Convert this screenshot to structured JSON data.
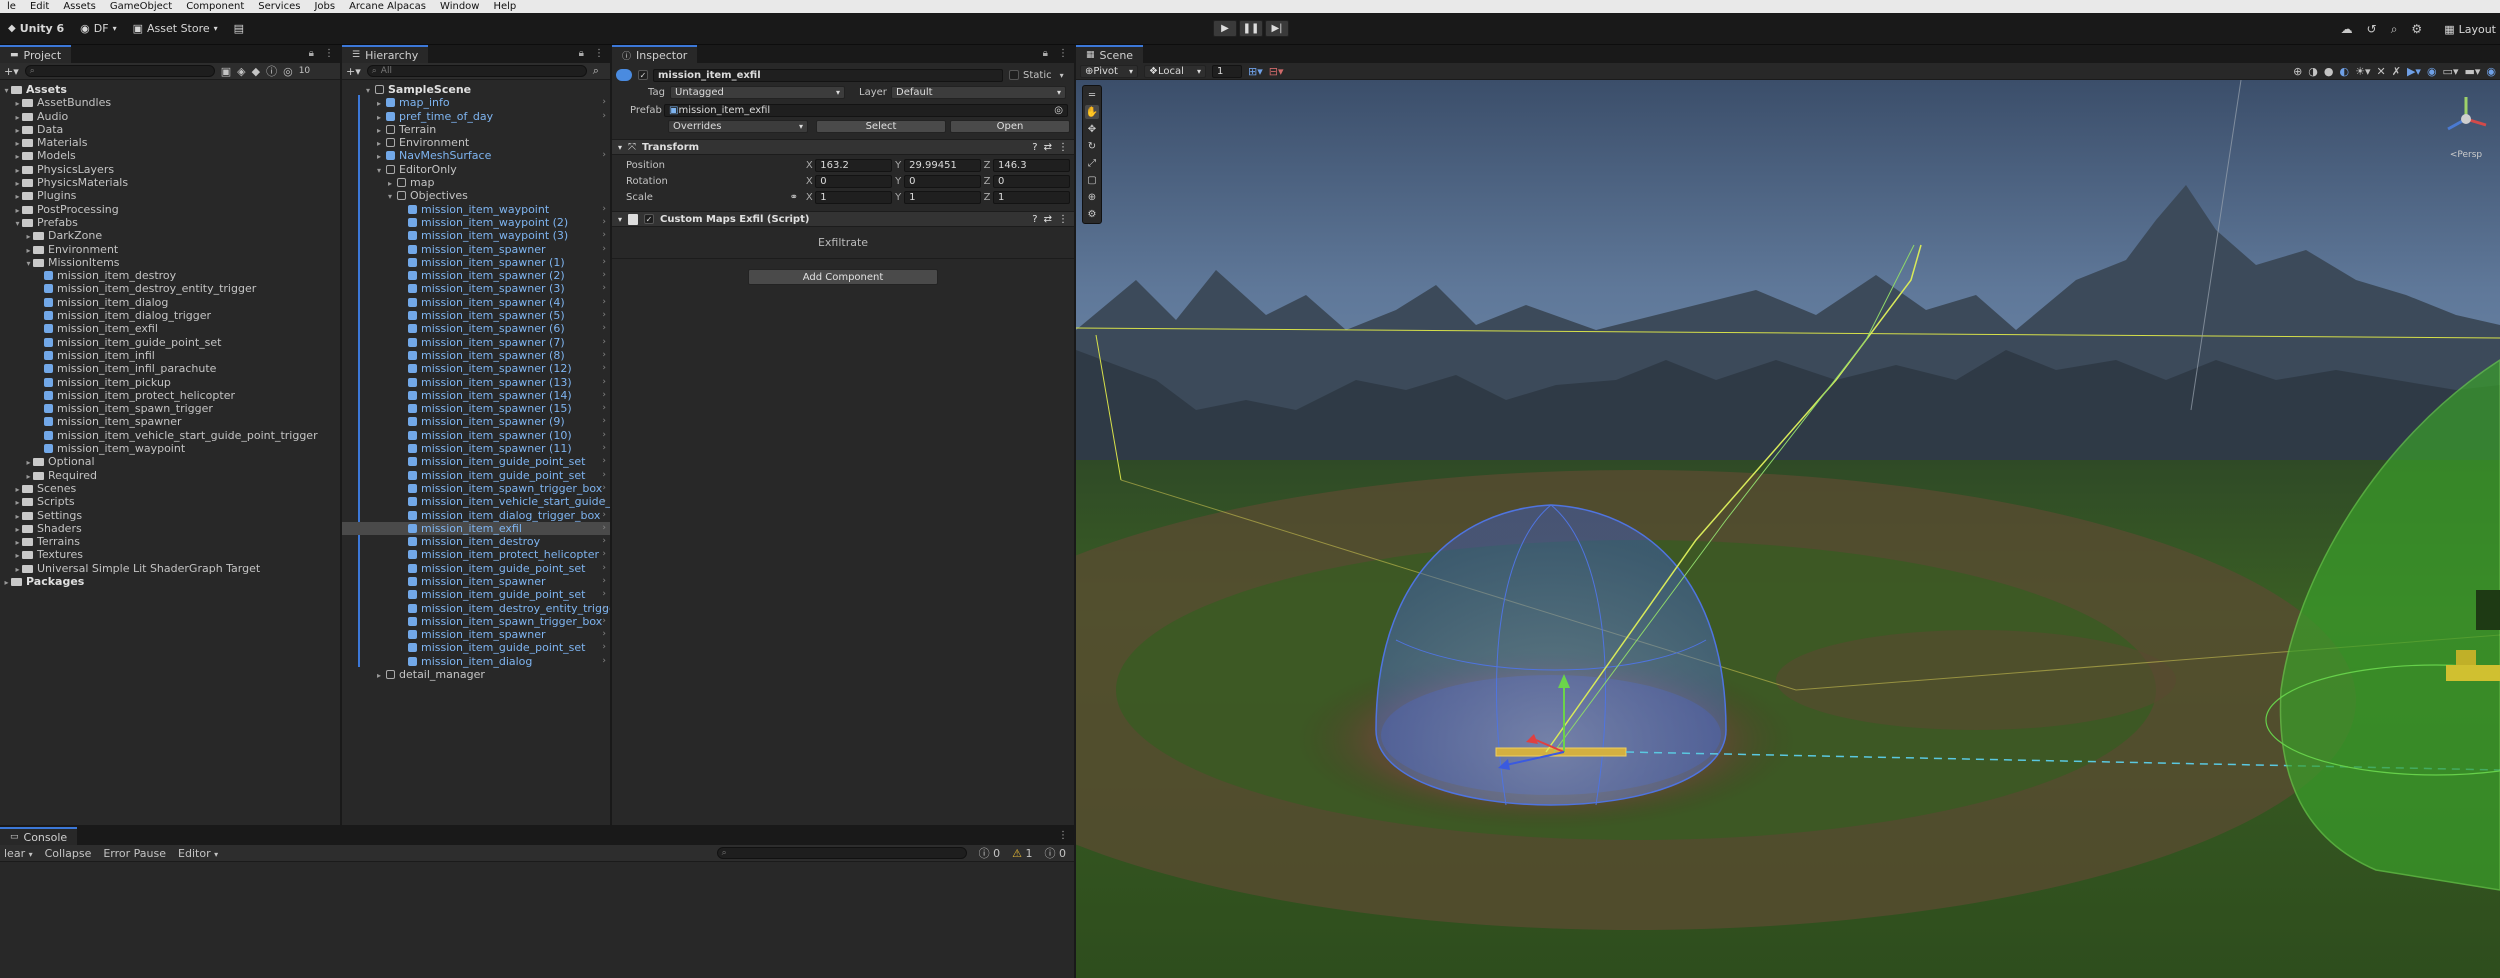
{
  "menu": [
    "le",
    "Edit",
    "Assets",
    "GameObject",
    "Component",
    "Services",
    "Jobs",
    "Arcane Alpacas",
    "Window",
    "Help"
  ],
  "toolbar": {
    "app": "Unity 6",
    "account": "DF",
    "asset_store": "Asset Store",
    "right_label": "Layout"
  },
  "project": {
    "tab": "Project",
    "filter_count": "10",
    "tree": [
      {
        "label": "Assets",
        "depth": 0,
        "type": "folder",
        "bold": true,
        "open": true
      },
      {
        "label": "AssetBundles",
        "depth": 1,
        "type": "folder"
      },
      {
        "label": "Audio",
        "depth": 1,
        "type": "folder"
      },
      {
        "label": "Data",
        "depth": 1,
        "type": "folder"
      },
      {
        "label": "Materials",
        "depth": 1,
        "type": "folder"
      },
      {
        "label": "Models",
        "depth": 1,
        "type": "folder"
      },
      {
        "label": "PhysicsLayers",
        "depth": 1,
        "type": "folder"
      },
      {
        "label": "PhysicsMaterials",
        "depth": 1,
        "type": "folder"
      },
      {
        "label": "Plugins",
        "depth": 1,
        "type": "folder"
      },
      {
        "label": "PostProcessing",
        "depth": 1,
        "type": "folder"
      },
      {
        "label": "Prefabs",
        "depth": 1,
        "type": "folder",
        "open": true
      },
      {
        "label": "DarkZone",
        "depth": 2,
        "type": "folder"
      },
      {
        "label": "Environment",
        "depth": 2,
        "type": "folder"
      },
      {
        "label": "MissionItems",
        "depth": 2,
        "type": "folder",
        "open": true
      },
      {
        "label": "mission_item_destroy",
        "depth": 3,
        "type": "prefab"
      },
      {
        "label": "mission_item_destroy_entity_trigger",
        "depth": 3,
        "type": "prefab"
      },
      {
        "label": "mission_item_dialog",
        "depth": 3,
        "type": "prefab"
      },
      {
        "label": "mission_item_dialog_trigger",
        "depth": 3,
        "type": "prefab"
      },
      {
        "label": "mission_item_exfil",
        "depth": 3,
        "type": "prefab"
      },
      {
        "label": "mission_item_guide_point_set",
        "depth": 3,
        "type": "prefab"
      },
      {
        "label": "mission_item_infil",
        "depth": 3,
        "type": "prefab"
      },
      {
        "label": "mission_item_infil_parachute",
        "depth": 3,
        "type": "prefab"
      },
      {
        "label": "mission_item_pickup",
        "depth": 3,
        "type": "prefab"
      },
      {
        "label": "mission_item_protect_helicopter",
        "depth": 3,
        "type": "prefab"
      },
      {
        "label": "mission_item_spawn_trigger",
        "depth": 3,
        "type": "prefab"
      },
      {
        "label": "mission_item_spawner",
        "depth": 3,
        "type": "prefab"
      },
      {
        "label": "mission_item_vehicle_start_guide_point_trigger",
        "depth": 3,
        "type": "prefab"
      },
      {
        "label": "mission_item_waypoint",
        "depth": 3,
        "type": "prefab"
      },
      {
        "label": "Optional",
        "depth": 2,
        "type": "folder"
      },
      {
        "label": "Required",
        "depth": 2,
        "type": "folder"
      },
      {
        "label": "Scenes",
        "depth": 1,
        "type": "folder"
      },
      {
        "label": "Scripts",
        "depth": 1,
        "type": "folder"
      },
      {
        "label": "Settings",
        "depth": 1,
        "type": "folder"
      },
      {
        "label": "Shaders",
        "depth": 1,
        "type": "folder"
      },
      {
        "label": "Terrains",
        "depth": 1,
        "type": "folder"
      },
      {
        "label": "Textures",
        "depth": 1,
        "type": "folder"
      },
      {
        "label": "Universal Simple Lit ShaderGraph Target",
        "depth": 1,
        "type": "folder"
      },
      {
        "label": "Packages",
        "depth": 0,
        "type": "folder",
        "bold": true
      }
    ]
  },
  "hierarchy": {
    "tab": "Hierarchy",
    "search_placeholder": "All",
    "items": [
      {
        "label": "SampleScene",
        "depth": 0,
        "type": "scene",
        "bold": true
      },
      {
        "label": "map_info",
        "depth": 1,
        "type": "prefab"
      },
      {
        "label": "pref_time_of_day",
        "depth": 1,
        "type": "prefab"
      },
      {
        "label": "Terrain",
        "depth": 1,
        "type": "go"
      },
      {
        "label": "Environment",
        "depth": 1,
        "type": "go"
      },
      {
        "label": "NavMeshSurface",
        "depth": 1,
        "type": "prefab"
      },
      {
        "label": "EditorOnly",
        "depth": 1,
        "type": "go"
      },
      {
        "label": "map",
        "depth": 2,
        "type": "go"
      },
      {
        "label": "Objectives",
        "depth": 2,
        "type": "go"
      },
      {
        "label": "mission_item_waypoint",
        "depth": 3,
        "type": "prefab"
      },
      {
        "label": "mission_item_waypoint (2)",
        "depth": 3,
        "type": "prefab"
      },
      {
        "label": "mission_item_waypoint (3)",
        "depth": 3,
        "type": "prefab"
      },
      {
        "label": "mission_item_spawner",
        "depth": 3,
        "type": "prefab"
      },
      {
        "label": "mission_item_spawner (1)",
        "depth": 3,
        "type": "prefab"
      },
      {
        "label": "mission_item_spawner (2)",
        "depth": 3,
        "type": "prefab"
      },
      {
        "label": "mission_item_spawner (3)",
        "depth": 3,
        "type": "prefab"
      },
      {
        "label": "mission_item_spawner (4)",
        "depth": 3,
        "type": "prefab"
      },
      {
        "label": "mission_item_spawner (5)",
        "depth": 3,
        "type": "prefab"
      },
      {
        "label": "mission_item_spawner (6)",
        "depth": 3,
        "type": "prefab"
      },
      {
        "label": "mission_item_spawner (7)",
        "depth": 3,
        "type": "prefab"
      },
      {
        "label": "mission_item_spawner (8)",
        "depth": 3,
        "type": "prefab"
      },
      {
        "label": "mission_item_spawner (12)",
        "depth": 3,
        "type": "prefab"
      },
      {
        "label": "mission_item_spawner (13)",
        "depth": 3,
        "type": "prefab"
      },
      {
        "label": "mission_item_spawner (14)",
        "depth": 3,
        "type": "prefab"
      },
      {
        "label": "mission_item_spawner (15)",
        "depth": 3,
        "type": "prefab"
      },
      {
        "label": "mission_item_spawner (9)",
        "depth": 3,
        "type": "prefab"
      },
      {
        "label": "mission_item_spawner (10)",
        "depth": 3,
        "type": "prefab"
      },
      {
        "label": "mission_item_spawner (11)",
        "depth": 3,
        "type": "prefab"
      },
      {
        "label": "mission_item_guide_point_set",
        "depth": 3,
        "type": "prefab"
      },
      {
        "label": "mission_item_guide_point_set",
        "depth": 3,
        "type": "prefab"
      },
      {
        "label": "mission_item_spawn_trigger_box",
        "depth": 3,
        "type": "prefab"
      },
      {
        "label": "mission_item_vehicle_start_guide_p",
        "depth": 3,
        "type": "prefab"
      },
      {
        "label": "mission_item_dialog_trigger_box",
        "depth": 3,
        "type": "prefab"
      },
      {
        "label": "mission_item_exfil",
        "depth": 3,
        "type": "prefab",
        "selected": true
      },
      {
        "label": "mission_item_destroy",
        "depth": 3,
        "type": "prefab"
      },
      {
        "label": "mission_item_protect_helicopter",
        "depth": 3,
        "type": "prefab"
      },
      {
        "label": "mission_item_guide_point_set",
        "depth": 3,
        "type": "prefab"
      },
      {
        "label": "mission_item_spawner",
        "depth": 3,
        "type": "prefab"
      },
      {
        "label": "mission_item_guide_point_set",
        "depth": 3,
        "type": "prefab"
      },
      {
        "label": "mission_item_destroy_entity_trigger",
        "depth": 3,
        "type": "prefab"
      },
      {
        "label": "mission_item_spawn_trigger_box",
        "depth": 3,
        "type": "prefab"
      },
      {
        "label": "mission_item_spawner",
        "depth": 3,
        "type": "prefab"
      },
      {
        "label": "mission_item_guide_point_set",
        "depth": 3,
        "type": "prefab"
      },
      {
        "label": "mission_item_dialog",
        "depth": 3,
        "type": "prefab"
      },
      {
        "label": "detail_manager",
        "depth": 1,
        "type": "go"
      }
    ]
  },
  "inspector": {
    "tab": "Inspector",
    "object_name": "mission_item_exfil",
    "static_label": "Static",
    "tag_label": "Tag",
    "tag_value": "Untagged",
    "layer_label": "Layer",
    "layer_value": "Default",
    "prefab_label": "Prefab",
    "prefab_value": "mission_item_exfil",
    "overrides_label": "Overrides",
    "select_label": "Select",
    "open_label": "Open",
    "transform_title": "Transform",
    "position_label": "Position",
    "rotation_label": "Rotation",
    "scale_label": "Scale",
    "position": {
      "x": "163.2",
      "y": "29.99451",
      "z": "146.3"
    },
    "rotation": {
      "x": "0",
      "y": "0",
      "z": "0"
    },
    "scale": {
      "x": "1",
      "y": "1",
      "z": "1"
    },
    "script_title": "Custom Maps Exfil (Script)",
    "script_body": "Exfiltrate",
    "add_component": "Add Component"
  },
  "scene": {
    "tab": "Scene",
    "pivot": "Pivot",
    "local": "Local",
    "grid_value": "1",
    "persp_label": "<Persp"
  },
  "console": {
    "tab": "Console",
    "clear": "lear",
    "collapse": "Collapse",
    "error_pause": "Error Pause",
    "editor": "Editor",
    "count_log": "0",
    "count_warn": "1",
    "count_err": "0"
  },
  "colors": {
    "accent": "#3c78d8",
    "prefab_text": "#7eb4f0",
    "panel": "#282828",
    "sky_top": "#3a4d68",
    "grass": "#35591f"
  }
}
